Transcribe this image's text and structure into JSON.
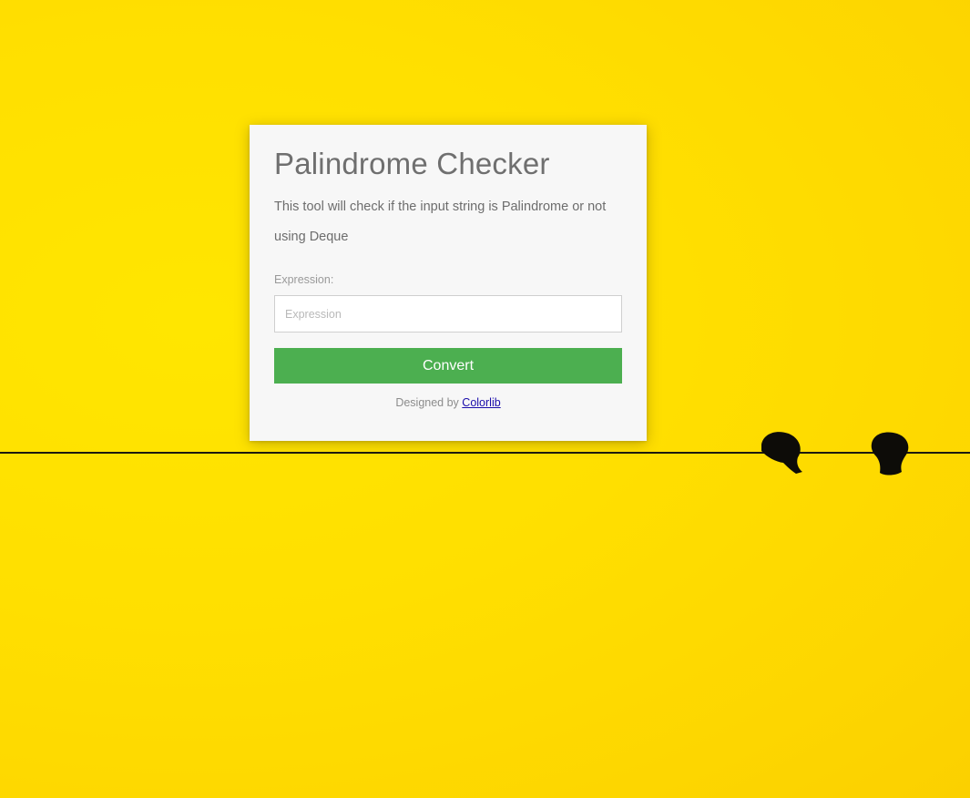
{
  "card": {
    "title": "Palindrome Checker",
    "description": "This tool will check if the input string is Palindrome or not using Deque",
    "expression_label": "Expression:",
    "expression_placeholder": "Expression",
    "expression_value": "",
    "convert_label": "Convert",
    "footer_prefix": "Designed by",
    "footer_link": "Colorlib"
  },
  "colors": {
    "background": "#ffe000",
    "card_background": "#f7f7f7",
    "button": "#4caf50",
    "link": "#1a0dab"
  }
}
